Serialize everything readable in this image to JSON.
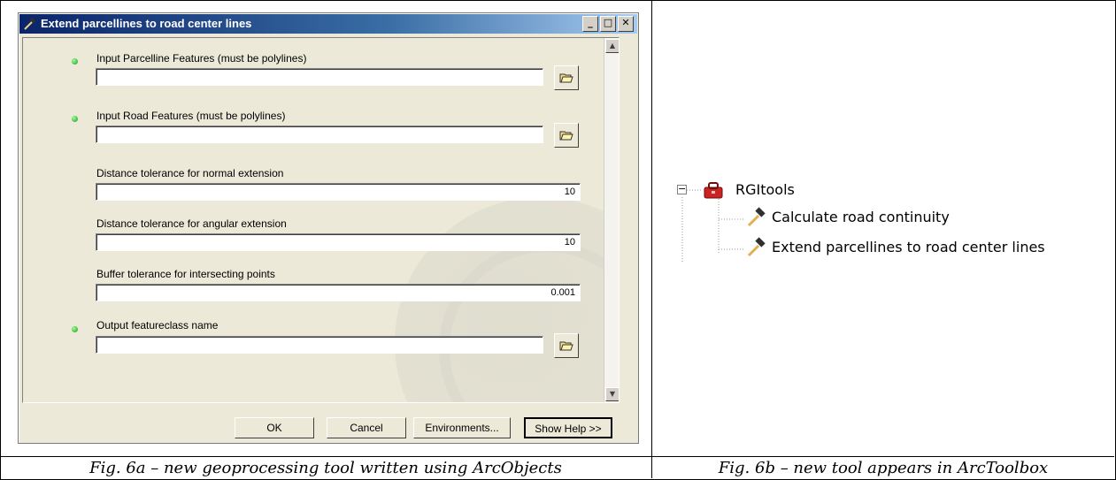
{
  "dialog": {
    "title": "Extend parcellines to road center lines",
    "title_buttons": [
      "_",
      "□",
      "✕"
    ],
    "params": [
      {
        "label": "Input Parcelline Features (must be polylines)",
        "required": true,
        "value": "",
        "browse": true
      },
      {
        "label": "Input Road Features (must be polylines)",
        "required": true,
        "value": "",
        "browse": true
      },
      {
        "label": "Distance tolerance for normal extension",
        "required": false,
        "value": "10",
        "browse": false
      },
      {
        "label": "Distance tolerance for angular extension",
        "required": false,
        "value": "10",
        "browse": false
      },
      {
        "label": "Buffer tolerance for intersecting points",
        "required": false,
        "value": "0.001",
        "browse": false
      },
      {
        "label": "Output featureclass name",
        "required": true,
        "value": "",
        "browse": true
      }
    ],
    "buttons": {
      "ok": "OK",
      "cancel": "Cancel",
      "environments": "Environments...",
      "help": "Show Help >>"
    }
  },
  "toolbox": {
    "root": "RGItools",
    "expander": "−",
    "items": [
      "Calculate road continuity",
      "Extend parcellines to road center lines"
    ]
  },
  "captions": {
    "left": "Fig. 6a – new geoprocessing tool written using ArcObjects",
    "right": "Fig. 6b – new tool appears in ArcToolbox"
  },
  "colors": {
    "required_dot": "#1a9a1a",
    "titlebar": "#0a246a",
    "toolbox_icon": "#cc2222"
  }
}
